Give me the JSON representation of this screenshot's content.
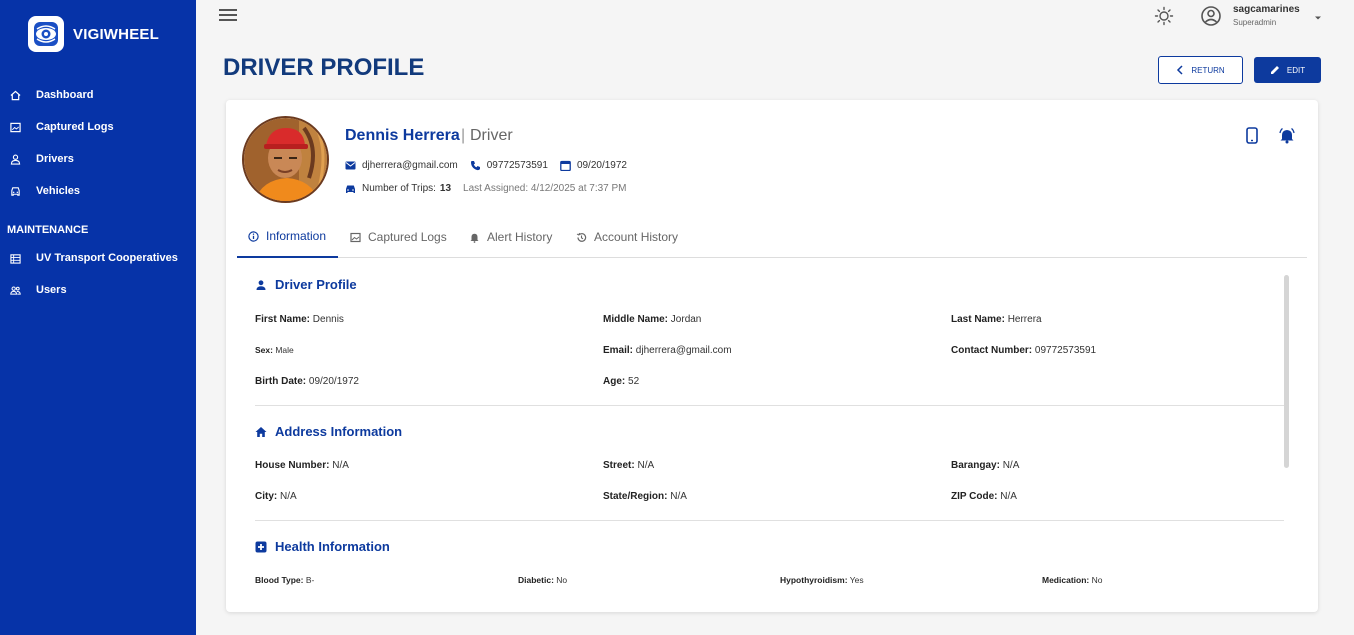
{
  "brand": {
    "name": "VIGIWHEEL"
  },
  "sidebar": {
    "items": [
      {
        "label": "Dashboard",
        "icon": "home-icon"
      },
      {
        "label": "Captured Logs",
        "icon": "image-icon"
      },
      {
        "label": "Drivers",
        "icon": "person-icon"
      },
      {
        "label": "Vehicles",
        "icon": "car-icon"
      }
    ],
    "section_label": "MAINTENANCE",
    "maintenance_items": [
      {
        "label": "UV Transport Cooperatives",
        "icon": "building-icon"
      },
      {
        "label": "Users",
        "icon": "users-icon"
      }
    ]
  },
  "topbar": {
    "username": "sagcamarines",
    "role": "Superadmin"
  },
  "page": {
    "title": "DRIVER PROFILE",
    "return_label": "RETURN",
    "edit_label": "EDIT"
  },
  "profile": {
    "name": "Dennis Herrera",
    "separator": "|",
    "role": "Driver",
    "email": "djherrera@gmail.com",
    "phone": "09772573591",
    "birthdate": "09/20/1972",
    "trips_label": "Number of Trips:",
    "trips": "13",
    "last_assigned": "Last Assigned: 4/12/2025 at 7:37 PM"
  },
  "tabs": [
    {
      "label": "Information",
      "active": true
    },
    {
      "label": "Captured Logs",
      "active": false
    },
    {
      "label": "Alert History",
      "active": false
    },
    {
      "label": "Account History",
      "active": false
    }
  ],
  "driver_profile": {
    "title": "Driver Profile",
    "first_name": {
      "label": "First Name:",
      "value": "Dennis"
    },
    "middle_name": {
      "label": "Middle Name:",
      "value": "Jordan"
    },
    "last_name": {
      "label": "Last Name:",
      "value": "Herrera"
    },
    "sex": {
      "label": "Sex:",
      "value": "Male"
    },
    "email": {
      "label": "Email:",
      "value": "djherrera@gmail.com"
    },
    "contact": {
      "label": "Contact Number:",
      "value": "09772573591"
    },
    "birth_date": {
      "label": "Birth Date:",
      "value": "09/20/1972"
    },
    "age": {
      "label": "Age:",
      "value": "52"
    }
  },
  "address": {
    "title": "Address Information",
    "house": {
      "label": "House Number:",
      "value": "N/A"
    },
    "street": {
      "label": "Street:",
      "value": "N/A"
    },
    "barangay": {
      "label": "Barangay:",
      "value": "N/A"
    },
    "city": {
      "label": "City:",
      "value": "N/A"
    },
    "state": {
      "label": "State/Region:",
      "value": "N/A"
    },
    "zip": {
      "label": "ZIP Code:",
      "value": "N/A"
    }
  },
  "health": {
    "title": "Health Information",
    "blood_type": {
      "label": "Blood Type:",
      "value": "B-"
    },
    "diabetic": {
      "label": "Diabetic:",
      "value": "No"
    },
    "hypothyroidism": {
      "label": "Hypothyroidism:",
      "value": "Yes"
    },
    "medication": {
      "label": "Medication:",
      "value": "No"
    }
  },
  "colors": {
    "sidebar": "#0633a8",
    "accent": "#0d3a9e",
    "title": "#123a7c"
  }
}
